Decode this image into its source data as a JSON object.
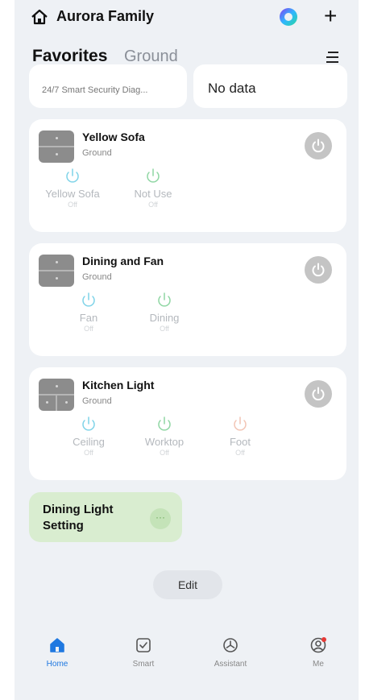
{
  "header": {
    "family_name": "Aurora Family",
    "home_icon": "home-icon",
    "assistant_icon": "orb-icon",
    "add_icon": "plus-icon"
  },
  "tabs": {
    "items": [
      {
        "label": "Favorites",
        "active": true
      },
      {
        "label": "Ground",
        "active": false
      }
    ],
    "menu_icon": "menu-icon"
  },
  "top_cards": {
    "left_text": "24/7 Smart Security Diag...",
    "right_text": "No data"
  },
  "devices": [
    {
      "name": "Yellow Sofa",
      "room": "Ground",
      "gangs": [
        {
          "label": "Yellow Sofa",
          "state": "Off",
          "color": "#7fd3e8"
        },
        {
          "label": "Not Use",
          "state": "Off",
          "color": "#8fd6a3"
        }
      ]
    },
    {
      "name": "Dining and Fan",
      "room": "Ground",
      "gangs": [
        {
          "label": "Fan",
          "state": "Off",
          "color": "#7fd3e8"
        },
        {
          "label": "Dining",
          "state": "Off",
          "color": "#8fd6a3"
        }
      ]
    },
    {
      "name": "Kitchen Light",
      "room": "Ground",
      "gangs": [
        {
          "label": "Ceiling",
          "state": "Off",
          "color": "#7fd3e8"
        },
        {
          "label": "Worktop",
          "state": "Off",
          "color": "#8fd6a3"
        },
        {
          "label": "Foot",
          "state": "Off",
          "color": "#f2c4b4"
        }
      ]
    }
  ],
  "scene": {
    "name": "Dining Light Setting",
    "more_label": "···"
  },
  "edit_label": "Edit",
  "bottom_nav": [
    {
      "label": "Home",
      "icon": "home-icon",
      "active": true
    },
    {
      "label": "Smart",
      "icon": "smart-icon",
      "active": false
    },
    {
      "label": "Assistant",
      "icon": "assistant-icon",
      "active": false
    },
    {
      "label": "Me",
      "icon": "profile-icon",
      "active": false,
      "badge": true
    }
  ],
  "colors": {
    "accent": "#1f78e0",
    "background": "#eef1f5",
    "scene_bg": "#d9edd0",
    "badge": "#e53935"
  }
}
